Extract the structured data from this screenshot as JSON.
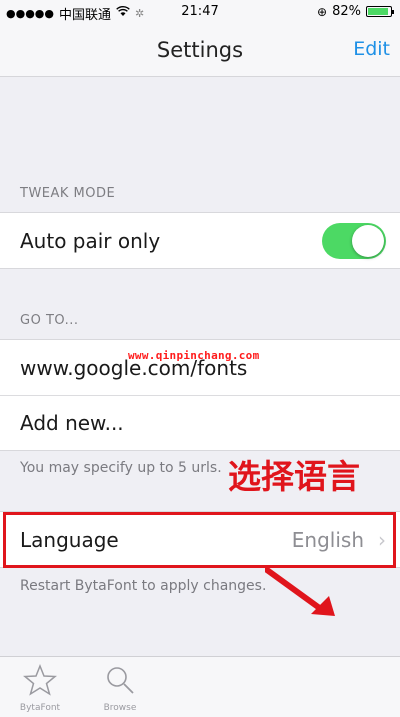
{
  "status_bar": {
    "carrier": "中国联通",
    "signal_dots": "●●●●●",
    "time": "21:47",
    "battery_percent": "82%",
    "battery_level": 0.82
  },
  "nav": {
    "title": "Settings",
    "edit_label": "Edit"
  },
  "tweak_mode": {
    "header": "TWEAK MODE",
    "auto_pair_label": "Auto pair only",
    "auto_pair_on": true
  },
  "goto": {
    "header": "GO TO...",
    "url_item": "www.google.com/fonts",
    "add_new_label": "Add new...",
    "footer": "You may specify up to 5 urls."
  },
  "language": {
    "label": "Language",
    "value": "English",
    "footer": "Restart BytaFont to apply changes."
  },
  "overlay": {
    "watermark": "www.qinpinchang.com",
    "annotation": "选择语言",
    "accent_color": "#e0151c"
  },
  "tabbar": {
    "tabs": [
      {
        "label": "BytaFont",
        "icon": "star-icon"
      },
      {
        "label": "Browse",
        "icon": "search-icon"
      }
    ]
  },
  "colors": {
    "toggle_on": "#4cd964",
    "link": "#1e90e6"
  }
}
